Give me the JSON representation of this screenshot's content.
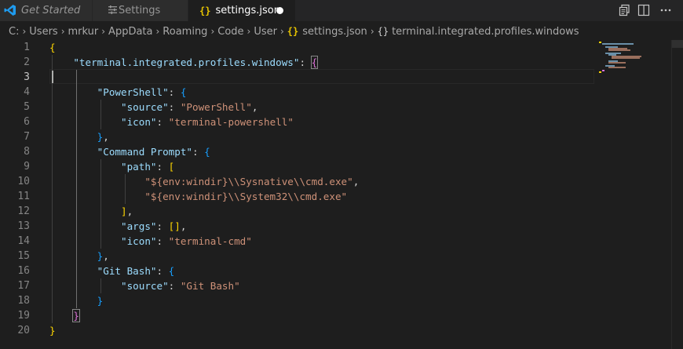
{
  "tabs": [
    {
      "label": "Get Started",
      "active": false
    },
    {
      "label": "Settings",
      "active": false
    },
    {
      "label": "settings.json",
      "active": true,
      "dirty": true
    }
  ],
  "breadcrumb": [
    "C:",
    "Users",
    "mrkur",
    "AppData",
    "Roaming",
    "Code",
    "User",
    "settings.json",
    "terminal.integrated.profiles.windows"
  ],
  "editor": {
    "active_line": 3,
    "lines": [
      {
        "n": "1"
      },
      {
        "n": "2"
      },
      {
        "n": "3"
      },
      {
        "n": "4"
      },
      {
        "n": "5"
      },
      {
        "n": "6"
      },
      {
        "n": "7"
      },
      {
        "n": "8"
      },
      {
        "n": "9"
      },
      {
        "n": "10"
      },
      {
        "n": "11"
      },
      {
        "n": "12"
      },
      {
        "n": "13"
      },
      {
        "n": "14"
      },
      {
        "n": "15"
      },
      {
        "n": "16"
      },
      {
        "n": "17"
      },
      {
        "n": "18"
      },
      {
        "n": "19"
      },
      {
        "n": "20"
      }
    ],
    "tokens": {
      "profiles_key": "\"terminal.integrated.profiles.windows\"",
      "ps_key": "\"PowerShell\"",
      "source_key": "\"source\"",
      "ps_val": "\"PowerShell\"",
      "icon_key": "\"icon\"",
      "ps_icon": "\"terminal-powershell\"",
      "cmd_key": "\"Command Prompt\"",
      "path_key": "\"path\"",
      "path1": "\"${env:windir}\\\\Sysnative\\\\cmd.exe\"",
      "path2": "\"${env:windir}\\\\System32\\\\cmd.exe\"",
      "args_key": "\"args\"",
      "cmd_icon": "\"terminal-cmd\"",
      "bash_key": "\"Git Bash\"",
      "bash_val": "\"Git Bash\""
    }
  },
  "colors": {
    "background": "#1e1e1e",
    "key": "#9cdcfe",
    "string": "#ce9178",
    "bracket_level1": "#ffd700",
    "bracket_level2": "#da70d6",
    "bracket_level3": "#179fff"
  },
  "icons": [
    "vscode-logo-icon",
    "settings-icon",
    "json-braces-icon",
    "open-preview-icon",
    "split-editor-icon",
    "more-actions-icon",
    "json-object-icon"
  ]
}
